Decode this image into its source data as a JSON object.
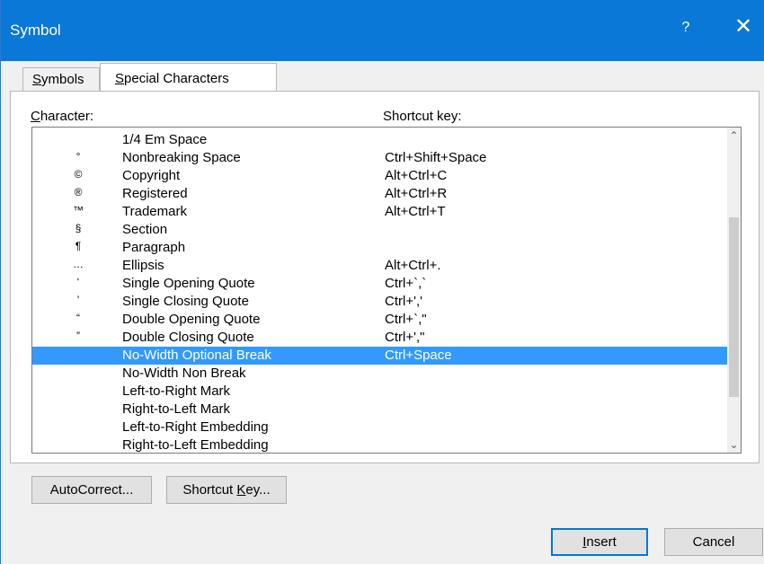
{
  "window": {
    "title": "Symbol",
    "help_label": "?",
    "close_label": "✕"
  },
  "tabs": [
    {
      "label_underlined": "S",
      "label_rest": "ymbols"
    },
    {
      "label_underlined": "S",
      "label_rest": "pecial Characters"
    }
  ],
  "labels": {
    "character_underlined": "C",
    "character_rest": "haracter:",
    "shortcut_key": "Shortcut key:"
  },
  "rows": [
    {
      "symbol": "",
      "name": "1/4 Em Space",
      "key": ""
    },
    {
      "symbol": "°",
      "name": "Nonbreaking Space",
      "key": "Ctrl+Shift+Space"
    },
    {
      "symbol": "©",
      "name": "Copyright",
      "key": "Alt+Ctrl+C"
    },
    {
      "symbol": "®",
      "name": "Registered",
      "key": "Alt+Ctrl+R"
    },
    {
      "symbol": "™",
      "name": "Trademark",
      "key": "Alt+Ctrl+T"
    },
    {
      "symbol": "§",
      "name": "Section",
      "key": ""
    },
    {
      "symbol": "¶",
      "name": "Paragraph",
      "key": ""
    },
    {
      "symbol": "…",
      "name": "Ellipsis",
      "key": "Alt+Ctrl+."
    },
    {
      "symbol": "‘",
      "name": "Single Opening Quote",
      "key": "Ctrl+`,`"
    },
    {
      "symbol": "’",
      "name": "Single Closing Quote",
      "key": "Ctrl+','"
    },
    {
      "symbol": "“",
      "name": "Double Opening Quote",
      "key": "Ctrl+`,\""
    },
    {
      "symbol": "”",
      "name": "Double Closing Quote",
      "key": "Ctrl+',\""
    },
    {
      "symbol": "",
      "name": "No-Width Optional Break",
      "key": "Ctrl+Space"
    },
    {
      "symbol": "",
      "name": "No-Width Non Break",
      "key": ""
    },
    {
      "symbol": "",
      "name": "Left-to-Right Mark",
      "key": ""
    },
    {
      "symbol": "",
      "name": "Right-to-Left Mark",
      "key": ""
    },
    {
      "symbol": "",
      "name": "Left-to-Right Embedding",
      "key": ""
    },
    {
      "symbol": "",
      "name": "Right-to-Left Embedding",
      "key": ""
    }
  ],
  "selected_row_name": "No-Width Optional Break",
  "scrollbar": {
    "up_icon": "⌃",
    "down_icon": "⌄"
  },
  "buttons": {
    "autocorrect": "AutoCorrect...",
    "shortcut_pre": "Shortcut ",
    "shortcut_u": "K",
    "shortcut_post": "ey...",
    "insert_u": "I",
    "insert_rest": "nsert",
    "cancel": "Cancel"
  },
  "colors": {
    "titlebar": "#0a78d6",
    "selection": "#3399ff",
    "insert_border": "#0078d7"
  }
}
